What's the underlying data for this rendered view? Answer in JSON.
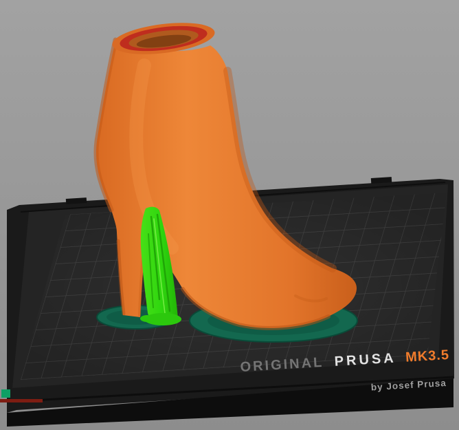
{
  "viewport": {
    "background_color": "#9b9b9b"
  },
  "bed": {
    "label": {
      "original": "ORIGINAL",
      "prusa": "PRUSA",
      "model": "MK3.5",
      "byline": "by Josef Prusa"
    },
    "colors": {
      "frame": "#191919",
      "sheet": "#242424",
      "grid_line": "#3d3d3d",
      "label_muted": "#747474",
      "label_bright": "#e3e3e3",
      "label_accent": "#f07c2c"
    }
  },
  "objects": {
    "model": {
      "name": "high-heel boot",
      "color": "#e87a2e",
      "rim_color": "#bf2d1e"
    },
    "support": {
      "name": "support tree",
      "color": "#2fd60f"
    },
    "pads": {
      "name": "support pads",
      "color": "#13684f"
    }
  }
}
